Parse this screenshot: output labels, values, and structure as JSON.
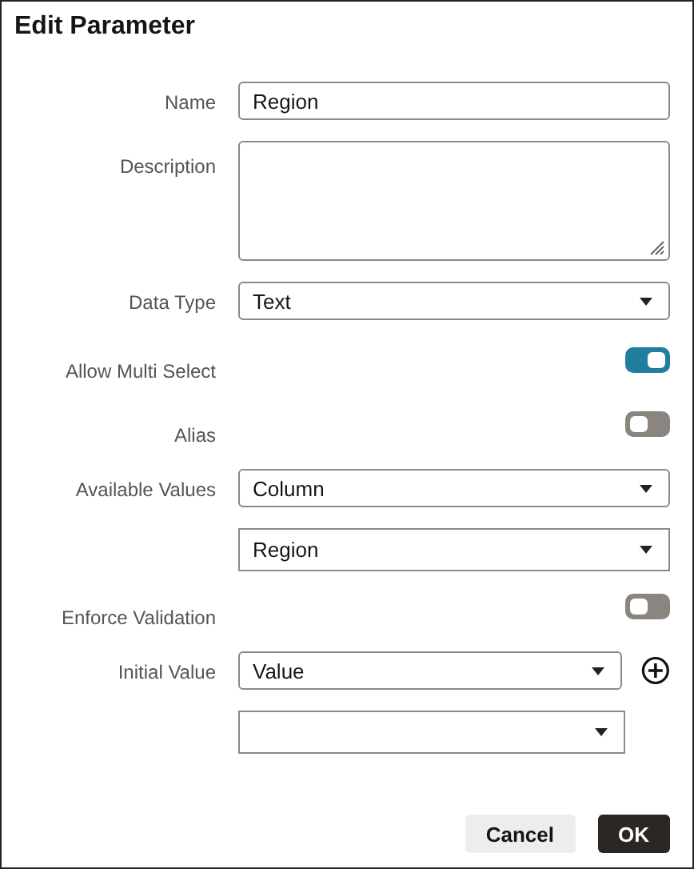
{
  "dialog": {
    "title": "Edit Parameter"
  },
  "rows": [
    {
      "label": "Name",
      "kind": "text",
      "value": "Region"
    },
    {
      "label": "Description",
      "kind": "textarea",
      "value": ""
    },
    {
      "label": "Data Type",
      "kind": "select",
      "value": "Text"
    },
    {
      "label": "Allow Multi Select",
      "kind": "toggle",
      "on": true
    },
    {
      "label": "Alias",
      "kind": "toggle",
      "on": false
    },
    {
      "label": "Available Values",
      "kind": "select",
      "value": "Column"
    },
    {
      "kind": "select",
      "value": "Region"
    },
    {
      "label": "Enforce Validation",
      "kind": "toggle",
      "on": false
    },
    {
      "label": "Initial Value",
      "kind": "select_add",
      "value": "Value"
    },
    {
      "kind": "select_narrow",
      "value": ""
    }
  ],
  "buttons": [
    {
      "label": "Cancel",
      "kind": "secondary"
    },
    {
      "label": "OK",
      "kind": "primary"
    }
  ]
}
